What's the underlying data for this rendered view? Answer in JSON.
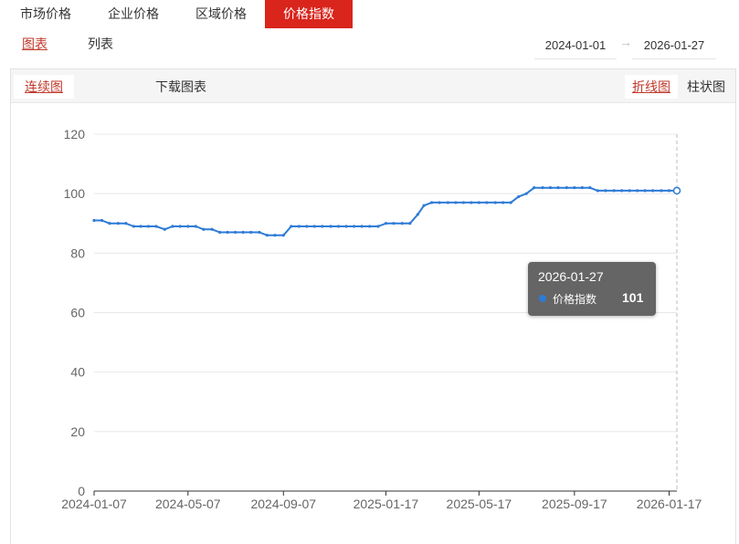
{
  "tabs": [
    {
      "label": "市场价格"
    },
    {
      "label": "企业价格"
    },
    {
      "label": "区域价格"
    },
    {
      "label": "价格指数",
      "active": true
    }
  ],
  "subnav": {
    "chart": "图表",
    "list": "列表"
  },
  "date_range": {
    "start": "2024-01-01",
    "end": "2026-01-27",
    "arrow": "→"
  },
  "panel": {
    "continuous": "连续图",
    "download": "下载图表",
    "line": "折线图",
    "bar": "柱状图"
  },
  "tooltip": {
    "date": "2026-01-27",
    "name": "价格指数",
    "value": "101"
  },
  "colors": {
    "accent": "#d9251c",
    "line": "#2e7bd6",
    "link": "#c0392b"
  },
  "chart_data": {
    "type": "line",
    "ylim": [
      0,
      120
    ],
    "yticks": [
      0,
      20,
      40,
      60,
      80,
      100,
      120
    ],
    "xticks": [
      "2024-01-07",
      "2024-05-07",
      "2024-09-07",
      "2025-01-17",
      "2025-05-17",
      "2025-09-17",
      "2026-01-17"
    ],
    "grid": true,
    "series": [
      {
        "name": "价格指数",
        "x": [
          "2024-01-07",
          "2024-01-17",
          "2024-01-27",
          "2024-02-07",
          "2024-02-17",
          "2024-02-27",
          "2024-03-07",
          "2024-03-17",
          "2024-03-27",
          "2024-04-07",
          "2024-04-17",
          "2024-04-27",
          "2024-05-07",
          "2024-05-17",
          "2024-05-27",
          "2024-06-07",
          "2024-06-17",
          "2024-06-27",
          "2024-07-07",
          "2024-07-17",
          "2024-07-27",
          "2024-08-07",
          "2024-08-17",
          "2024-08-27",
          "2024-09-07",
          "2024-09-17",
          "2024-09-27",
          "2024-10-07",
          "2024-10-17",
          "2024-10-27",
          "2024-11-07",
          "2024-11-17",
          "2024-11-27",
          "2024-12-07",
          "2024-12-17",
          "2024-12-27",
          "2025-01-07",
          "2025-01-17",
          "2025-01-27",
          "2025-02-07",
          "2025-02-17",
          "2025-02-27",
          "2025-03-07",
          "2025-03-17",
          "2025-03-27",
          "2025-04-07",
          "2025-04-17",
          "2025-04-27",
          "2025-05-07",
          "2025-05-17",
          "2025-05-27",
          "2025-06-07",
          "2025-06-17",
          "2025-06-27",
          "2025-07-07",
          "2025-07-17",
          "2025-07-27",
          "2025-08-07",
          "2025-08-17",
          "2025-08-27",
          "2025-09-07",
          "2025-09-17",
          "2025-09-27",
          "2025-10-07",
          "2025-10-17",
          "2025-10-27",
          "2025-11-07",
          "2025-11-17",
          "2025-11-27",
          "2025-12-07",
          "2025-12-17",
          "2025-12-27",
          "2026-01-07",
          "2026-01-17",
          "2026-01-27"
        ],
        "values": [
          91,
          91,
          90,
          90,
          90,
          89,
          89,
          89,
          89,
          88,
          89,
          89,
          89,
          89,
          88,
          88,
          87,
          87,
          87,
          87,
          87,
          87,
          86,
          86,
          86,
          89,
          89,
          89,
          89,
          89,
          89,
          89,
          89,
          89,
          89,
          89,
          89,
          90,
          90,
          90,
          90,
          93,
          96,
          97,
          97,
          97,
          97,
          97,
          97,
          97,
          97,
          97,
          97,
          97,
          99,
          100,
          102,
          102,
          102,
          102,
          102,
          102,
          102,
          102,
          101,
          101,
          101,
          101,
          101,
          101,
          101,
          101,
          101,
          101,
          101
        ]
      }
    ]
  }
}
